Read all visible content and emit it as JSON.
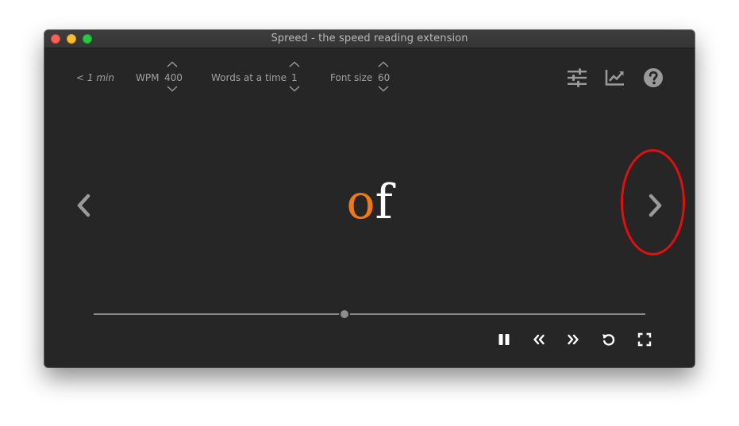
{
  "window": {
    "title": "Spreed - the speed reading extension"
  },
  "settings": {
    "time_estimate": "< 1 min",
    "wpm": {
      "label": "WPM",
      "value": "400"
    },
    "words_at_a_time": {
      "label": "Words at a time",
      "value": "1"
    },
    "font_size": {
      "label": "Font size",
      "value": "60"
    }
  },
  "toolbar": {
    "icons": [
      "sliders-icon",
      "chart-line-icon",
      "help-icon"
    ]
  },
  "reader": {
    "word_pivot": "o",
    "word_rest": "f",
    "pivot_color": "#f07a10",
    "text_color": "#ffffff"
  },
  "progress": {
    "fraction": 0.455
  },
  "controls": {
    "icons": [
      "pause-icon",
      "rewind-icon",
      "fast-forward-icon",
      "restart-icon",
      "fullscreen-icon"
    ]
  },
  "colors": {
    "background": "#262626",
    "annotation": "#e01010"
  }
}
